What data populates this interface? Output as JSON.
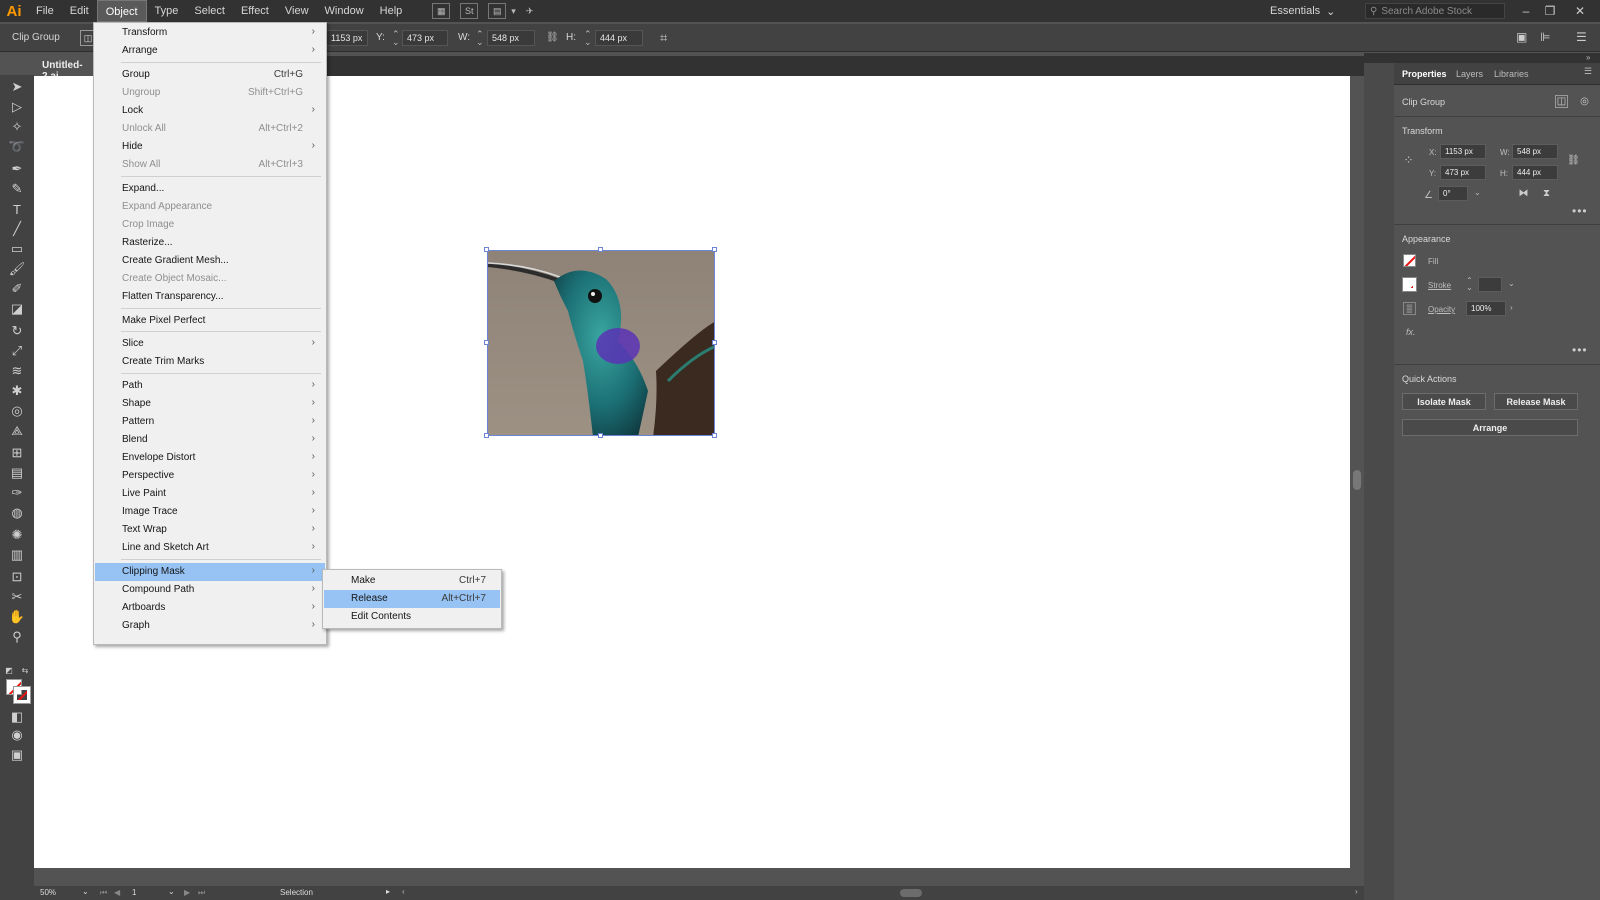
{
  "app": {
    "logo": "Ai",
    "menu": [
      "File",
      "Edit",
      "Object",
      "Type",
      "Select",
      "Effect",
      "View",
      "Window",
      "Help"
    ],
    "active_menu": "Object",
    "toolbar_icons": [
      "St"
    ],
    "workspace": "Essentials",
    "stock_search_placeholder": "Search Adobe Stock"
  },
  "controlbar": {
    "object_type": "Clip Group",
    "x_value": "1153 px",
    "y_label": "Y:",
    "y_value": "473 px",
    "w_label": "W:",
    "w_value": "548 px",
    "h_label": "H:",
    "h_value": "444 px"
  },
  "document": {
    "tab_title": "Untitled-2.ai"
  },
  "object_menu": {
    "items": [
      {
        "label": "Transform",
        "shortcut": "",
        "submenu": true,
        "disabled": false
      },
      {
        "label": "Arrange",
        "shortcut": "",
        "submenu": true,
        "disabled": false
      },
      {
        "label": "Group",
        "shortcut": "Ctrl+G",
        "submenu": false,
        "disabled": false
      },
      {
        "label": "Ungroup",
        "shortcut": "Shift+Ctrl+G",
        "submenu": false,
        "disabled": true
      },
      {
        "label": "Lock",
        "shortcut": "",
        "submenu": true,
        "disabled": false
      },
      {
        "label": "Unlock All",
        "shortcut": "Alt+Ctrl+2",
        "submenu": false,
        "disabled": true
      },
      {
        "label": "Hide",
        "shortcut": "",
        "submenu": true,
        "disabled": false
      },
      {
        "label": "Show All",
        "shortcut": "Alt+Ctrl+3",
        "submenu": false,
        "disabled": true
      },
      {
        "label": "Expand...",
        "shortcut": "",
        "submenu": false,
        "disabled": false
      },
      {
        "label": "Expand Appearance",
        "shortcut": "",
        "submenu": false,
        "disabled": true
      },
      {
        "label": "Crop Image",
        "shortcut": "",
        "submenu": false,
        "disabled": true
      },
      {
        "label": "Rasterize...",
        "shortcut": "",
        "submenu": false,
        "disabled": false
      },
      {
        "label": "Create Gradient Mesh...",
        "shortcut": "",
        "submenu": false,
        "disabled": false
      },
      {
        "label": "Create Object Mosaic...",
        "shortcut": "",
        "submenu": false,
        "disabled": true
      },
      {
        "label": "Flatten Transparency...",
        "shortcut": "",
        "submenu": false,
        "disabled": false
      },
      {
        "label": "Make Pixel Perfect",
        "shortcut": "",
        "submenu": false,
        "disabled": false
      },
      {
        "label": "Slice",
        "shortcut": "",
        "submenu": true,
        "disabled": false
      },
      {
        "label": "Create Trim Marks",
        "shortcut": "",
        "submenu": false,
        "disabled": false
      },
      {
        "label": "Path",
        "shortcut": "",
        "submenu": true,
        "disabled": false
      },
      {
        "label": "Shape",
        "shortcut": "",
        "submenu": true,
        "disabled": false
      },
      {
        "label": "Pattern",
        "shortcut": "",
        "submenu": true,
        "disabled": false
      },
      {
        "label": "Blend",
        "shortcut": "",
        "submenu": true,
        "disabled": false
      },
      {
        "label": "Envelope Distort",
        "shortcut": "",
        "submenu": true,
        "disabled": false
      },
      {
        "label": "Perspective",
        "shortcut": "",
        "submenu": true,
        "disabled": false
      },
      {
        "label": "Live Paint",
        "shortcut": "",
        "submenu": true,
        "disabled": false
      },
      {
        "label": "Image Trace",
        "shortcut": "",
        "submenu": true,
        "disabled": false
      },
      {
        "label": "Text Wrap",
        "shortcut": "",
        "submenu": true,
        "disabled": false
      },
      {
        "label": "Line and Sketch Art",
        "shortcut": "",
        "submenu": true,
        "disabled": false
      },
      {
        "label": "Clipping Mask",
        "shortcut": "",
        "submenu": true,
        "disabled": false,
        "highlight": true
      },
      {
        "label": "Compound Path",
        "shortcut": "",
        "submenu": true,
        "disabled": false
      },
      {
        "label": "Artboards",
        "shortcut": "",
        "submenu": true,
        "disabled": false
      },
      {
        "label": "Graph",
        "shortcut": "",
        "submenu": true,
        "disabled": false
      }
    ]
  },
  "clipping_submenu": {
    "items": [
      {
        "label": "Make",
        "shortcut": "Ctrl+7"
      },
      {
        "label": "Release",
        "shortcut": "Alt+Ctrl+7",
        "highlight": true
      },
      {
        "label": "Edit Contents",
        "shortcut": ""
      }
    ]
  },
  "properties_panel": {
    "tabs": [
      "Properties",
      "Layers",
      "Libraries"
    ],
    "active_tab": "Properties",
    "selection_type": "Clip Group",
    "transform": {
      "heading": "Transform",
      "x_label": "X:",
      "x_value": "1153 px",
      "y_label": "Y:",
      "y_value": "473 px",
      "w_label": "W:",
      "w_value": "548 px",
      "h_label": "H:",
      "h_value": "444 px",
      "angle_value": "0°"
    },
    "appearance": {
      "heading": "Appearance",
      "fill_label": "Fill",
      "stroke_label": "Stroke",
      "opacity_label": "Opacity",
      "opacity_value": "100%",
      "fx_label": "fx."
    },
    "quick_actions": {
      "heading": "Quick Actions",
      "isolate_mask": "Isolate Mask",
      "release_mask": "Release Mask",
      "arrange": "Arrange"
    }
  },
  "statusbar": {
    "zoom": "50%",
    "artboard": "1",
    "tool": "Selection"
  }
}
